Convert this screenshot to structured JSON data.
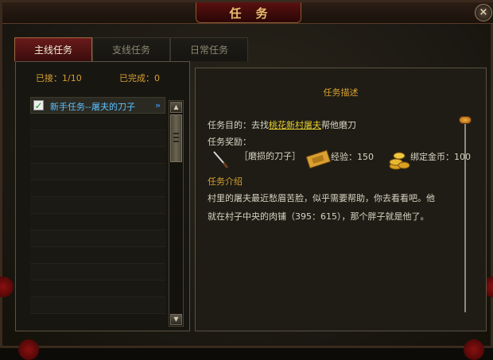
{
  "window": {
    "title": "任务",
    "close_glyph": "×"
  },
  "tabs": [
    {
      "label": "主线任务",
      "active": true
    },
    {
      "label": "支线任务",
      "active": false
    },
    {
      "label": "日常任务",
      "active": false
    }
  ],
  "counts": {
    "accepted": "已接：1/10",
    "completed": "已完成：0"
  },
  "quest_list": [
    {
      "name": "新手任务--屠夫的刀子",
      "checked": true,
      "arrow": "»"
    }
  ],
  "scroll": {
    "up": "▲",
    "down": "▼"
  },
  "detail": {
    "heading": "任务描述",
    "objective_prefix": "任务目的：去找",
    "objective_link": "桃花新村屠夫",
    "objective_suffix": "帮他磨刀",
    "reward_label": "任务奖励：",
    "reward_item": "［磨损的刀子］",
    "exp_label": "经验：150",
    "gold_label": "绑定金币：100",
    "intro_label": "任务介绍",
    "intro_line1": "村里的屠夫最近愁眉苦脸，似乎需要帮助，你去看看吧。他",
    "intro_line2": "就在村子中央的肉铺（395：615），那个胖子就是他了。"
  },
  "colors": {
    "accent_gold": "#d8a030",
    "link_yellow": "#e8d030",
    "quest_blue": "#5cc0ff",
    "tab_active": "#6a1a1a"
  }
}
